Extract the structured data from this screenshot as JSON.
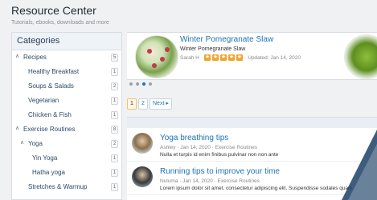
{
  "header": {
    "title": "Resource Center",
    "subtitle": "Tutorials, ebooks, downloads and more"
  },
  "sidebar": {
    "heading": "Categories",
    "items": [
      {
        "label": "Recipes",
        "count": "5",
        "expanded": true,
        "level": 0
      },
      {
        "label": "Healthy Breakfast",
        "count": "1",
        "level": 1
      },
      {
        "label": "Soups & Salads",
        "count": "2",
        "level": 1
      },
      {
        "label": "Vegetarian",
        "count": "1",
        "level": 1
      },
      {
        "label": "Chicken & Fish",
        "count": "1",
        "level": 1
      },
      {
        "label": "Exercise Routines",
        "count": "8",
        "expanded": true,
        "level": 0
      },
      {
        "label": "Yoga",
        "count": "2",
        "expanded": true,
        "level": 1
      },
      {
        "label": "Yin Yoga",
        "count": "1",
        "level": 2
      },
      {
        "label": "Hatha yoga",
        "count": "1",
        "level": 2
      },
      {
        "label": "Stretches & Warmup",
        "count": "1",
        "level": 1
      }
    ]
  },
  "featured": {
    "title": "Winter Pomegranate Slaw",
    "subtitle": "Winter Pomegranate Slaw",
    "author": "Sarah H",
    "rating": 5,
    "updated": "Updated: Jan 14, 2020",
    "accent": "#f0a32a"
  },
  "pagination": {
    "pages": [
      "1",
      "2"
    ],
    "current": "1",
    "next_label": "Next ▸"
  },
  "articles": [
    {
      "title": "Yoga breathing tips",
      "meta": "Ashley · Jan 14, 2020 · Exercise Routines",
      "snippet": "Nulla et turpis id enim finibus pulvinar non non ante"
    },
    {
      "title": "Running tips to improve your time",
      "meta": "Nuluma · Jan 14, 2020 · Exercise Routines",
      "snippet": "Lorem ipsum dolor sit amet, consectetur adipiscing elit. Suspendisse sodales quam"
    }
  ],
  "colors": {
    "link": "#1e73b8",
    "star": "#f0a32a",
    "sidebar_head_bg": "#eef3f8"
  }
}
